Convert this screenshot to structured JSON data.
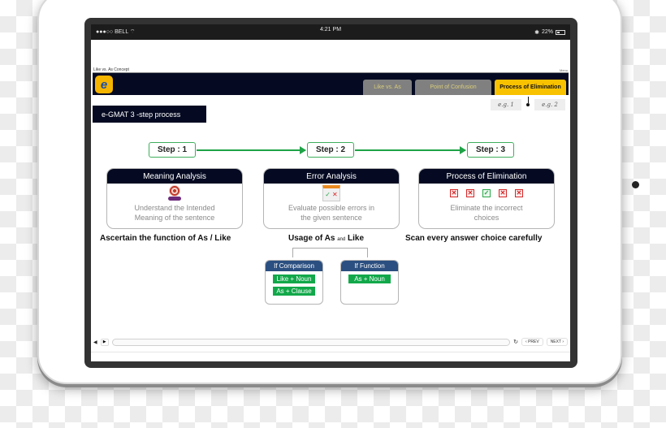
{
  "device": {
    "status_bar": {
      "carrier": "●●●○○ BELL",
      "wifi_icon": "wifi-icon",
      "time": "4:21 PM",
      "bluetooth": "✱",
      "battery": "22%"
    }
  },
  "course": {
    "title": "Like vs. As Concept",
    "menu_label": "Menu"
  },
  "navbar": {
    "logo_letter": "e",
    "tabs": [
      {
        "label": "Like vs. As",
        "active": false
      },
      {
        "label": "Point of Confusion",
        "active": false
      },
      {
        "label": "Process of Elimination",
        "active": true
      }
    ],
    "examples": [
      "e.g. 1",
      "e.g. 2"
    ]
  },
  "section_title": "e-GMAT 3 -step process",
  "steps": [
    {
      "step_label": "Step : 1",
      "card_title": "Meaning Analysis",
      "icon": "target-icon",
      "body_line1": "Understand the Intended",
      "body_line2": "Meaning of the sentence",
      "caption": "Ascertain the function of As / Like"
    },
    {
      "step_label": "Step : 2",
      "card_title": "Error Analysis",
      "icon": "calendar-check-icon",
      "body_line1": "Evaluate possible errors in",
      "body_line2": "the given sentence",
      "caption_part1": "Usage of As",
      "caption_small": "and",
      "caption_part2": "Like"
    },
    {
      "step_label": "Step : 3",
      "card_title": "Process of Elimination",
      "icon": "answer-choices-icon",
      "choices": [
        "✕",
        "✕",
        "✓",
        "✕",
        "✕"
      ],
      "body_line1": "Eliminate the incorrect",
      "body_line2": "choices",
      "caption": "Scan every answer choice carefully"
    }
  ],
  "sub_cases": [
    {
      "title": "If Comparison",
      "rules": [
        "Like + Noun",
        "As + Clause"
      ]
    },
    {
      "title": "If Function",
      "rules": [
        "As + Noun"
      ]
    }
  ],
  "player": {
    "volume_icon": "◀",
    "play_icon": "▶",
    "progress_fraction": 0.0,
    "replay_icon": "↻",
    "prev_label": "‹ PREV",
    "next_label": "NEXT ›"
  },
  "colors": {
    "navy": "#050a22",
    "active_tab": "#f8c200",
    "green": "#1fa347",
    "sub_head": "#2b4f80"
  }
}
